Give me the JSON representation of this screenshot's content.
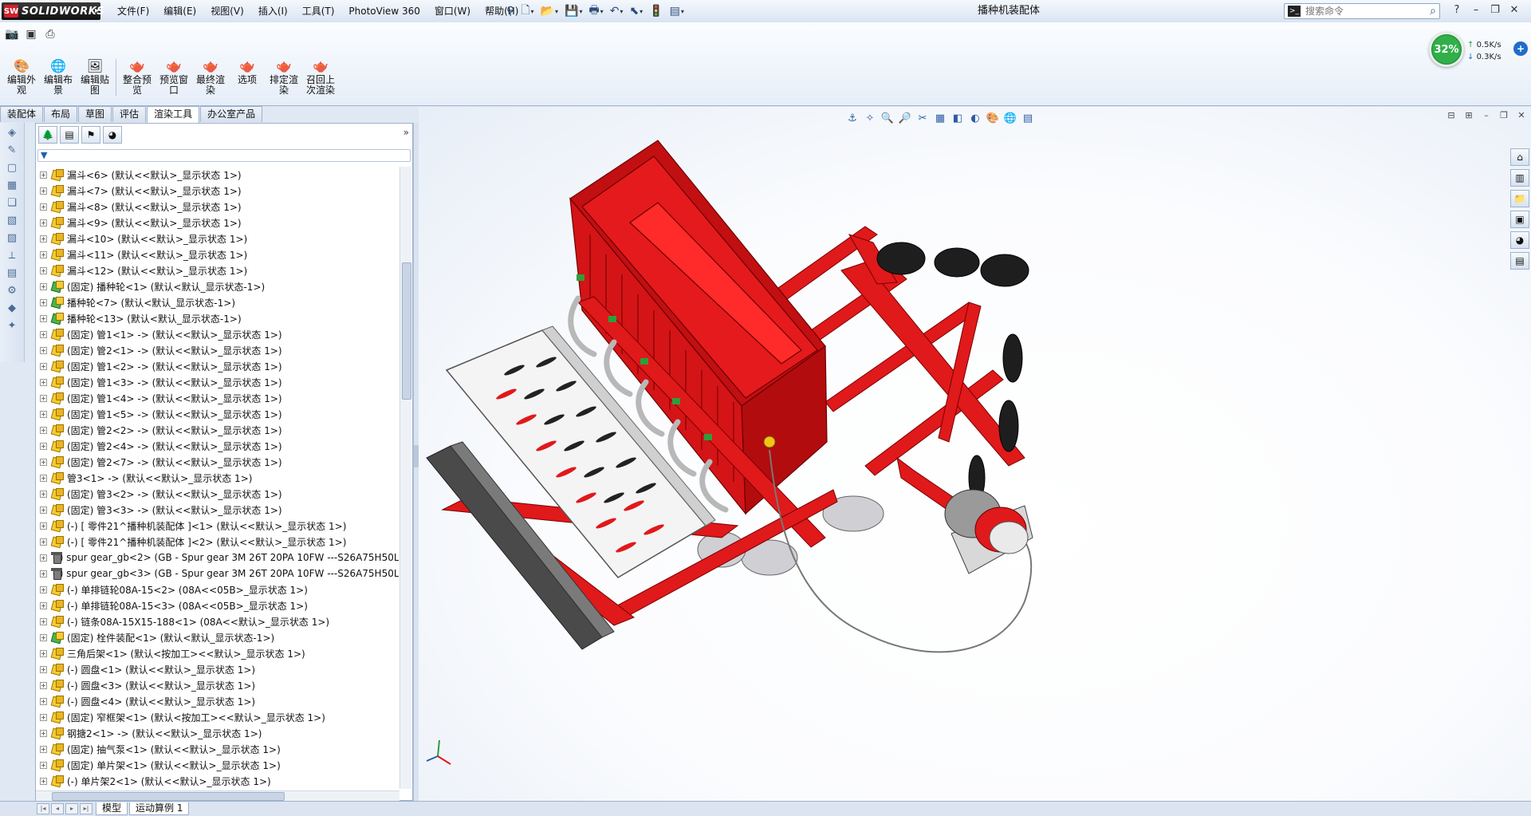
{
  "app": {
    "logo_text": "SOLIDWORKS",
    "menus": [
      "文件(F)",
      "编辑(E)",
      "视图(V)",
      "插入(I)",
      "工具(T)",
      "PhotoView 360",
      "窗口(W)",
      "帮助(H)"
    ],
    "document_title": "播种机装配体",
    "search_placeholder": "搜索命令"
  },
  "command_manager": {
    "buttons": [
      {
        "label": "编辑外观",
        "icon": "appearance-icon"
      },
      {
        "label": "编辑布景",
        "icon": "scene-icon"
      },
      {
        "label": "编辑贴图",
        "icon": "decal-icon"
      },
      {
        "label": "整合预览",
        "icon": "integrated-preview-icon"
      },
      {
        "label": "预览窗口",
        "icon": "preview-window-icon"
      },
      {
        "label": "最终渲染",
        "icon": "final-render-icon"
      },
      {
        "label": "选项",
        "icon": "options-icon"
      },
      {
        "label": "排定渲染",
        "icon": "schedule-render-icon"
      },
      {
        "label": "召回上次渲染",
        "icon": "recall-render-icon"
      }
    ]
  },
  "performance": {
    "percent": "32%",
    "upload": "0.5K/s",
    "download": "0.3K/s"
  },
  "tabs": [
    "装配体",
    "布局",
    "草图",
    "评估",
    "渲染工具",
    "办公室产品"
  ],
  "active_tab": "渲染工具",
  "feature_tree": {
    "items": [
      {
        "icon": "asm",
        "text": "漏斗<6> (默认<<默认>_显示状态 1>)"
      },
      {
        "icon": "asm",
        "text": "漏斗<7> (默认<<默认>_显示状态 1>)"
      },
      {
        "icon": "asm",
        "text": "漏斗<8> (默认<<默认>_显示状态 1>)"
      },
      {
        "icon": "asm",
        "text": "漏斗<9> (默认<<默认>_显示状态 1>)"
      },
      {
        "icon": "asm",
        "text": "漏斗<10> (默认<<默认>_显示状态 1>)"
      },
      {
        "icon": "asm",
        "text": "漏斗<11> (默认<<默认>_显示状态 1>)"
      },
      {
        "icon": "asm",
        "text": "漏斗<12> (默认<<默认>_显示状态 1>)"
      },
      {
        "icon": "fixed",
        "text": "(固定) 播种轮<1> (默认<默认_显示状态-1>)"
      },
      {
        "icon": "fixed",
        "text": "播种轮<7> (默认<默认_显示状态-1>)"
      },
      {
        "icon": "fixed",
        "text": "播种轮<13> (默认<默认_显示状态-1>)"
      },
      {
        "icon": "asm",
        "text": "(固定) 管1<1> -> (默认<<默认>_显示状态 1>)"
      },
      {
        "icon": "asm",
        "text": "(固定) 管2<1> -> (默认<<默认>_显示状态 1>)"
      },
      {
        "icon": "asm",
        "text": "(固定) 管1<2> -> (默认<<默认>_显示状态 1>)"
      },
      {
        "icon": "asm",
        "text": "(固定) 管1<3> -> (默认<<默认>_显示状态 1>)"
      },
      {
        "icon": "asm",
        "text": "(固定) 管1<4> -> (默认<<默认>_显示状态 1>)"
      },
      {
        "icon": "asm",
        "text": "(固定) 管1<5> -> (默认<<默认>_显示状态 1>)"
      },
      {
        "icon": "asm",
        "text": "(固定) 管2<2> -> (默认<<默认>_显示状态 1>)"
      },
      {
        "icon": "asm",
        "text": "(固定) 管2<4> -> (默认<<默认>_显示状态 1>)"
      },
      {
        "icon": "asm",
        "text": "(固定) 管2<7> -> (默认<<默认>_显示状态 1>)"
      },
      {
        "icon": "asm",
        "text": "管3<1> -> (默认<<默认>_显示状态 1>)"
      },
      {
        "icon": "asm",
        "text": "(固定) 管3<2> -> (默认<<默认>_显示状态 1>)"
      },
      {
        "icon": "asm",
        "text": "(固定) 管3<3> -> (默认<<默认>_显示状态 1>)"
      },
      {
        "icon": "asm",
        "text": "(-) [ 零件21^播种机装配体 ]<1> (默认<<默认>_显示状态 1>)"
      },
      {
        "icon": "asm",
        "text": "(-) [ 零件21^播种机装配体 ]<2> (默认<<默认>_显示状态 1>)"
      },
      {
        "icon": "part",
        "text": "(-) spur gear_gb<2> (GB - Spur gear 3M 26T 20PA 10FW ---S26A75H50L"
      },
      {
        "icon": "part",
        "text": "(-) spur gear_gb<3> (GB - Spur gear 3M 26T 20PA 10FW ---S26A75H50L"
      },
      {
        "icon": "asm",
        "text": "(-) 单排链轮08A-15<2> (08A<<05B>_显示状态 1>)"
      },
      {
        "icon": "asm",
        "text": "(-) 单排链轮08A-15<3> (08A<<05B>_显示状态 1>)"
      },
      {
        "icon": "asm",
        "text": "(-) 链条08A-15X15-188<1> (08A<<默认>_显示状态 1>)"
      },
      {
        "icon": "fixed",
        "text": "(固定) 栓件装配<1> (默认<默认_显示状态-1>)"
      },
      {
        "icon": "asm",
        "text": "三角后架<1> (默认<按加工><<默认>_显示状态 1>)"
      },
      {
        "icon": "asm",
        "text": "(-) 圆盘<1> (默认<<默认>_显示状态 1>)"
      },
      {
        "icon": "asm",
        "text": "(-) 圆盘<3> (默认<<默认>_显示状态 1>)"
      },
      {
        "icon": "asm",
        "text": "(-) 圆盘<4> (默认<<默认>_显示状态 1>)"
      },
      {
        "icon": "asm",
        "text": "(固定) 窄框架<1> (默认<按加工><<默认>_显示状态 1>)"
      },
      {
        "icon": "asm",
        "text": "钢搪2<1> -> (默认<<默认>_显示状态 1>)"
      },
      {
        "icon": "asm",
        "text": "(固定) 抽气泵<1> (默认<<默认>_显示状态 1>)"
      },
      {
        "icon": "asm",
        "text": "(固定) 单片架<1> (默认<<默认>_显示状态 1>)"
      },
      {
        "icon": "asm",
        "text": "(-) 单片架2<1> (默认<<默认>_显示状态 1>)"
      }
    ]
  },
  "bottom_tabs": [
    "模型",
    "运动算例 1"
  ],
  "colors": {
    "model_red": "#e0191b",
    "plate_white": "#f4f4f4",
    "accent_blue": "#2b5ca6"
  }
}
